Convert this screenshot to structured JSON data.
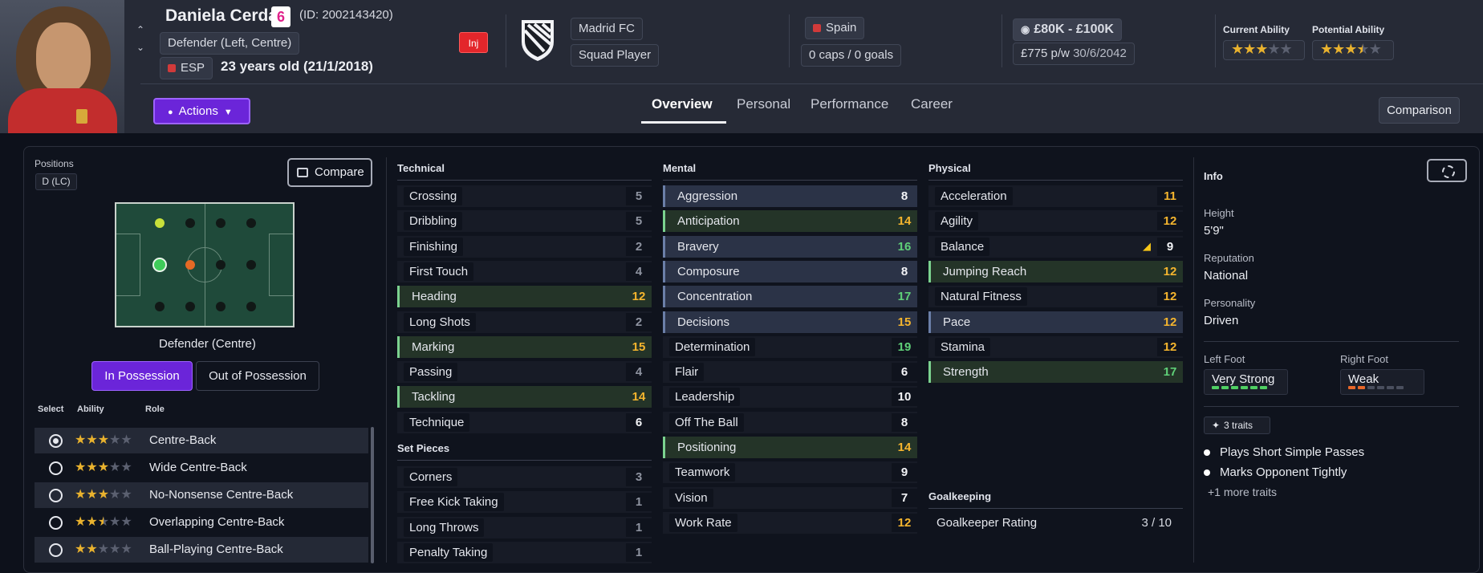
{
  "player": {
    "name": "Daniela Cerdá",
    "number": "6",
    "id": "(ID: 2002143420)",
    "position": "Defender (Left, Centre)",
    "nationality_code": "ESP",
    "age": "23 years old (21/1/2018)",
    "injury_badge": "Inj"
  },
  "club": {
    "name": "Madrid FC",
    "status": "Squad Player"
  },
  "nation": {
    "name": "Spain",
    "caps": "0 caps / 0 goals"
  },
  "value": {
    "range": "£80K - £100K",
    "wage": "£775 p/w",
    "contract": "30/6/2042"
  },
  "ability": {
    "current_label": "Current Ability",
    "current_stars": 3,
    "potential_label": "Potential Ability",
    "potential_stars": 3.5
  },
  "actions_label": "Actions",
  "tabs": [
    "Overview",
    "Personal",
    "Performance",
    "Career"
  ],
  "active_tab": "Overview",
  "comparison_label": "Comparison",
  "positions": {
    "label": "Positions",
    "chip": "D (LC)",
    "compare_label": "Compare",
    "role_title": "Defender (Centre)",
    "in_possession": "In Possession",
    "out_of_possession": "Out of Possession",
    "headers": {
      "select": "Select",
      "ability": "Ability",
      "role": "Role"
    },
    "roles": [
      {
        "name": "Centre-Back",
        "stars": 3,
        "selected": true
      },
      {
        "name": "Wide Centre-Back",
        "stars": 3,
        "selected": false
      },
      {
        "name": "No-Nonsense Centre-Back",
        "stars": 3,
        "selected": false
      },
      {
        "name": "Overlapping Centre-Back",
        "stars": 2.5,
        "selected": false
      },
      {
        "name": "Ball-Playing Centre-Back",
        "stars": 2,
        "selected": false
      }
    ]
  },
  "technical": {
    "title": "Technical",
    "attrs": [
      {
        "name": "Crossing",
        "value": "5",
        "hl": ""
      },
      {
        "name": "Dribbling",
        "value": "5",
        "hl": ""
      },
      {
        "name": "Finishing",
        "value": "2",
        "hl": ""
      },
      {
        "name": "First Touch",
        "value": "4",
        "hl": ""
      },
      {
        "name": "Heading",
        "value": "12",
        "hl": "g"
      },
      {
        "name": "Long Shots",
        "value": "2",
        "hl": ""
      },
      {
        "name": "Marking",
        "value": "15",
        "hl": "g"
      },
      {
        "name": "Passing",
        "value": "4",
        "hl": ""
      },
      {
        "name": "Tackling",
        "value": "14",
        "hl": "g"
      },
      {
        "name": "Technique",
        "value": "6",
        "hl": ""
      }
    ]
  },
  "set_pieces": {
    "title": "Set Pieces",
    "attrs": [
      {
        "name": "Corners",
        "value": "3",
        "hl": ""
      },
      {
        "name": "Free Kick Taking",
        "value": "1",
        "hl": ""
      },
      {
        "name": "Long Throws",
        "value": "1",
        "hl": ""
      },
      {
        "name": "Penalty Taking",
        "value": "1",
        "hl": ""
      }
    ]
  },
  "mental": {
    "title": "Mental",
    "attrs": [
      {
        "name": "Aggression",
        "value": "8",
        "hl": "b"
      },
      {
        "name": "Anticipation",
        "value": "14",
        "hl": "g"
      },
      {
        "name": "Bravery",
        "value": "16",
        "hl": "b"
      },
      {
        "name": "Composure",
        "value": "8",
        "hl": "b"
      },
      {
        "name": "Concentration",
        "value": "17",
        "hl": "b"
      },
      {
        "name": "Decisions",
        "value": "15",
        "hl": "b"
      },
      {
        "name": "Determination",
        "value": "19",
        "hl": ""
      },
      {
        "name": "Flair",
        "value": "6",
        "hl": ""
      },
      {
        "name": "Leadership",
        "value": "10",
        "hl": ""
      },
      {
        "name": "Off The Ball",
        "value": "8",
        "hl": ""
      },
      {
        "name": "Positioning",
        "value": "14",
        "hl": "g"
      },
      {
        "name": "Teamwork",
        "value": "9",
        "hl": ""
      },
      {
        "name": "Vision",
        "value": "7",
        "hl": ""
      },
      {
        "name": "Work Rate",
        "value": "12",
        "hl": ""
      }
    ]
  },
  "physical": {
    "title": "Physical",
    "attrs": [
      {
        "name": "Acceleration",
        "value": "11",
        "hl": ""
      },
      {
        "name": "Agility",
        "value": "12",
        "hl": ""
      },
      {
        "name": "Balance",
        "value": "9",
        "hl": "",
        "trend": true
      },
      {
        "name": "Jumping Reach",
        "value": "12",
        "hl": "g"
      },
      {
        "name": "Natural Fitness",
        "value": "12",
        "hl": ""
      },
      {
        "name": "Pace",
        "value": "12",
        "hl": "b"
      },
      {
        "name": "Stamina",
        "value": "12",
        "hl": ""
      },
      {
        "name": "Strength",
        "value": "17",
        "hl": "g"
      }
    ]
  },
  "goalkeeping": {
    "title": "Goalkeeping",
    "rating_label": "Goalkeeper Rating",
    "rating_value": "3 / 10"
  },
  "info": {
    "title": "Info",
    "height_label": "Height",
    "height": "5'9\"",
    "reputation_label": "Reputation",
    "reputation": "National",
    "personality_label": "Personality",
    "personality": "Driven",
    "left_foot_label": "Left Foot",
    "left_foot": "Very Strong",
    "left_foot_level": 6,
    "right_foot_label": "Right Foot",
    "right_foot": "Weak",
    "right_foot_level": 2,
    "traits_chip": "3 traits",
    "traits": [
      "Plays Short Simple Passes",
      "Marks Opponent Tightly"
    ],
    "more_traits": "+1 more traits"
  },
  "colors": {
    "accent": "#6b25d9",
    "green": "#5fd078",
    "orange": "#f5b52e",
    "grey": "#8e93a0",
    "white": "#f2f3f6",
    "injury": "#e3262b"
  }
}
